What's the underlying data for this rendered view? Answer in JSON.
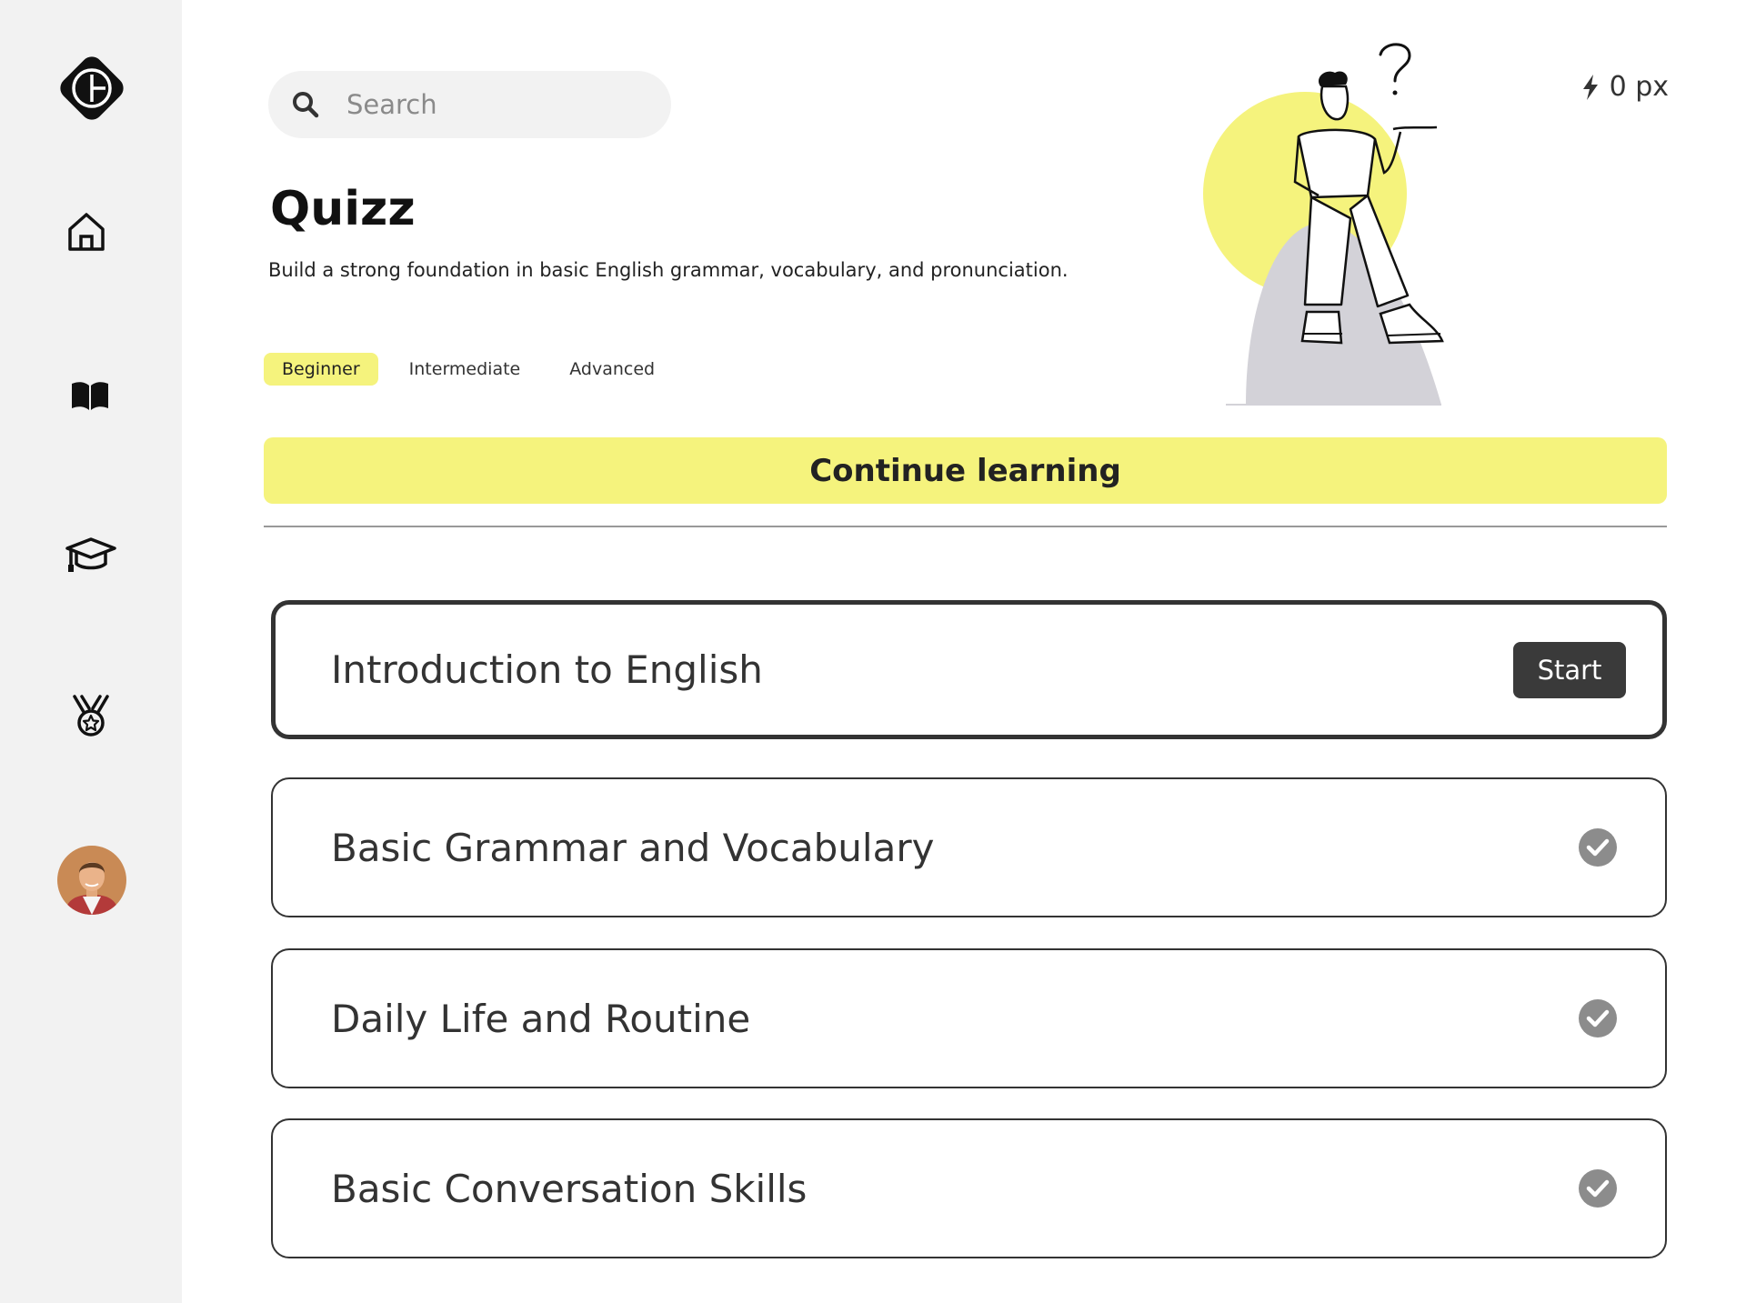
{
  "search": {
    "placeholder": "Search"
  },
  "header": {
    "title": "Quizz",
    "subtitle": "Build a strong foundation in basic English grammar, vocabulary, and pronunciation."
  },
  "levels": [
    {
      "label": "Beginner",
      "active": true
    },
    {
      "label": "Intermediate",
      "active": false
    },
    {
      "label": "Advanced",
      "active": false
    }
  ],
  "energy": {
    "value": "0 px",
    "icon": "bolt-icon"
  },
  "continue_label": "Continue learning",
  "lessons": [
    {
      "title": "Introduction to English",
      "status": "current",
      "action_label": "Start"
    },
    {
      "title": "Basic Grammar and Vocabulary",
      "status": "completed"
    },
    {
      "title": "Daily Life and Routine",
      "status": "completed"
    },
    {
      "title": "Basic Conversation Skills",
      "status": "completed"
    }
  ],
  "sidebar": {
    "icons": [
      "logo-icon",
      "home-icon",
      "book-icon",
      "graduation-cap-icon",
      "medal-icon",
      "avatar"
    ]
  },
  "colors": {
    "accent": "#f5f37d",
    "dark": "#3a3a3a",
    "sidebar_bg": "#f2f2f2",
    "check": "#8c8c8c"
  }
}
